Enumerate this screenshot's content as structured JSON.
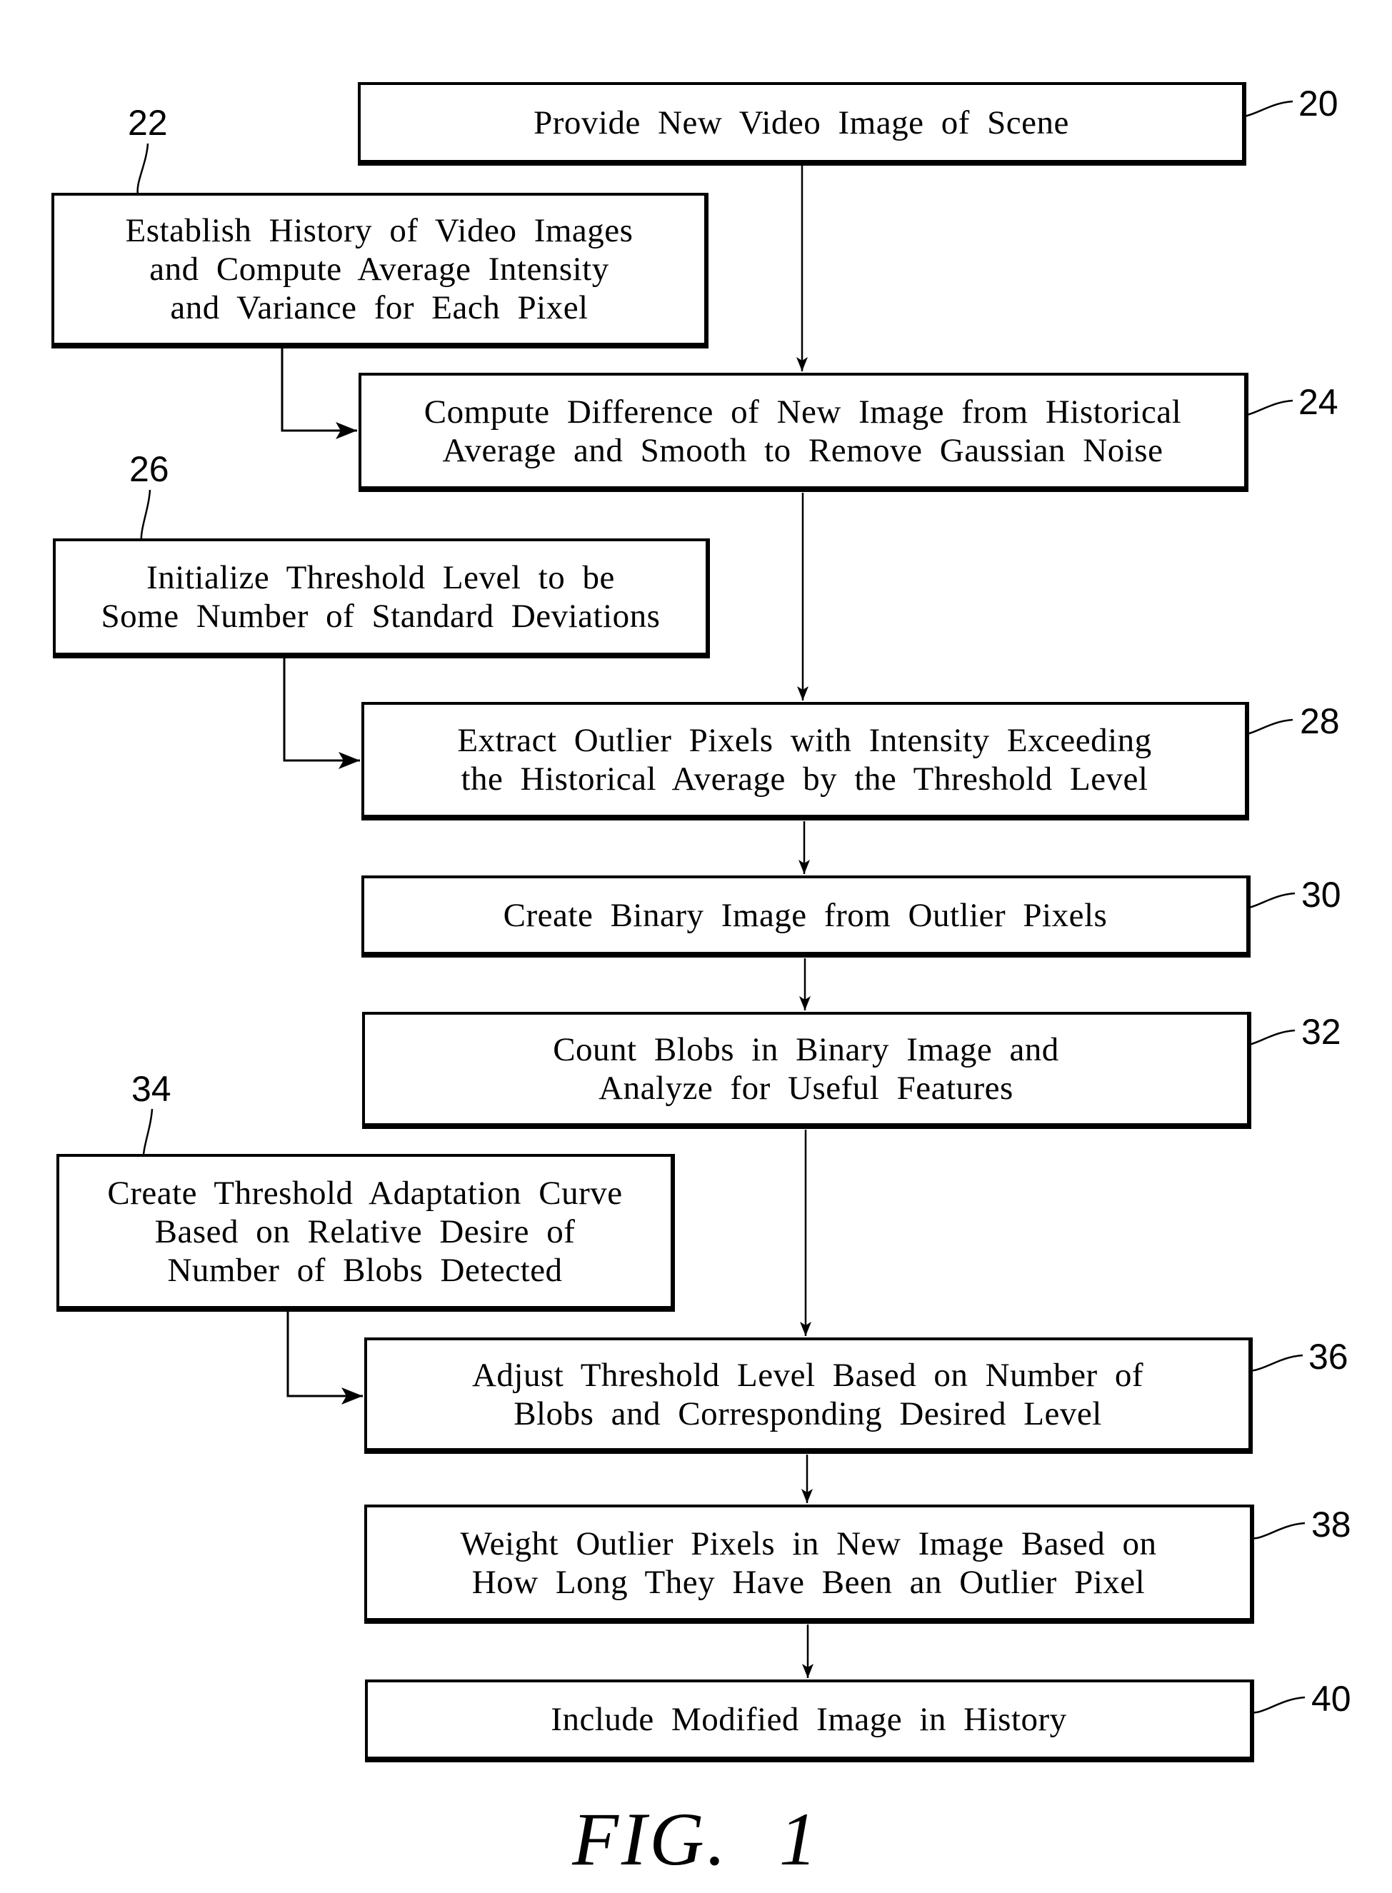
{
  "figure": {
    "caption": "FIG. 1",
    "steps": [
      {
        "ref": "20",
        "text": "Provide New Video Image of Scene"
      },
      {
        "ref": "22",
        "text": "Establish History of Video Images\nand Compute Average Intensity\nand Variance for Each Pixel"
      },
      {
        "ref": "24",
        "text": "Compute Difference of New Image from Historical\nAverage and Smooth to Remove Gaussian Noise"
      },
      {
        "ref": "26",
        "text": "Initialize Threshold Level to be\nSome Number of Standard Deviations"
      },
      {
        "ref": "28",
        "text": "Extract Outlier Pixels with Intensity Exceeding\nthe Historical Average by the Threshold Level"
      },
      {
        "ref": "30",
        "text": "Create Binary Image from Outlier Pixels"
      },
      {
        "ref": "32",
        "text": "Count Blobs in Binary Image and\nAnalyze for Useful Features"
      },
      {
        "ref": "34",
        "text": "Create Threshold Adaptation Curve\nBased on Relative Desire of\nNumber of Blobs Detected"
      },
      {
        "ref": "36",
        "text": "Adjust Threshold Level Based on Number of\nBlobs and Corresponding Desired Level"
      },
      {
        "ref": "38",
        "text": "Weight Outlier Pixels in New Image Based on\nHow Long They Have Been an Outlier Pixel"
      },
      {
        "ref": "40",
        "text": "Include Modified Image in History"
      }
    ],
    "flow": [
      [
        "20",
        "24"
      ],
      [
        "22",
        "24"
      ],
      [
        "24",
        "28"
      ],
      [
        "26",
        "28"
      ],
      [
        "28",
        "30"
      ],
      [
        "30",
        "32"
      ],
      [
        "32",
        "36"
      ],
      [
        "34",
        "36"
      ],
      [
        "36",
        "38"
      ],
      [
        "38",
        "40"
      ]
    ]
  }
}
